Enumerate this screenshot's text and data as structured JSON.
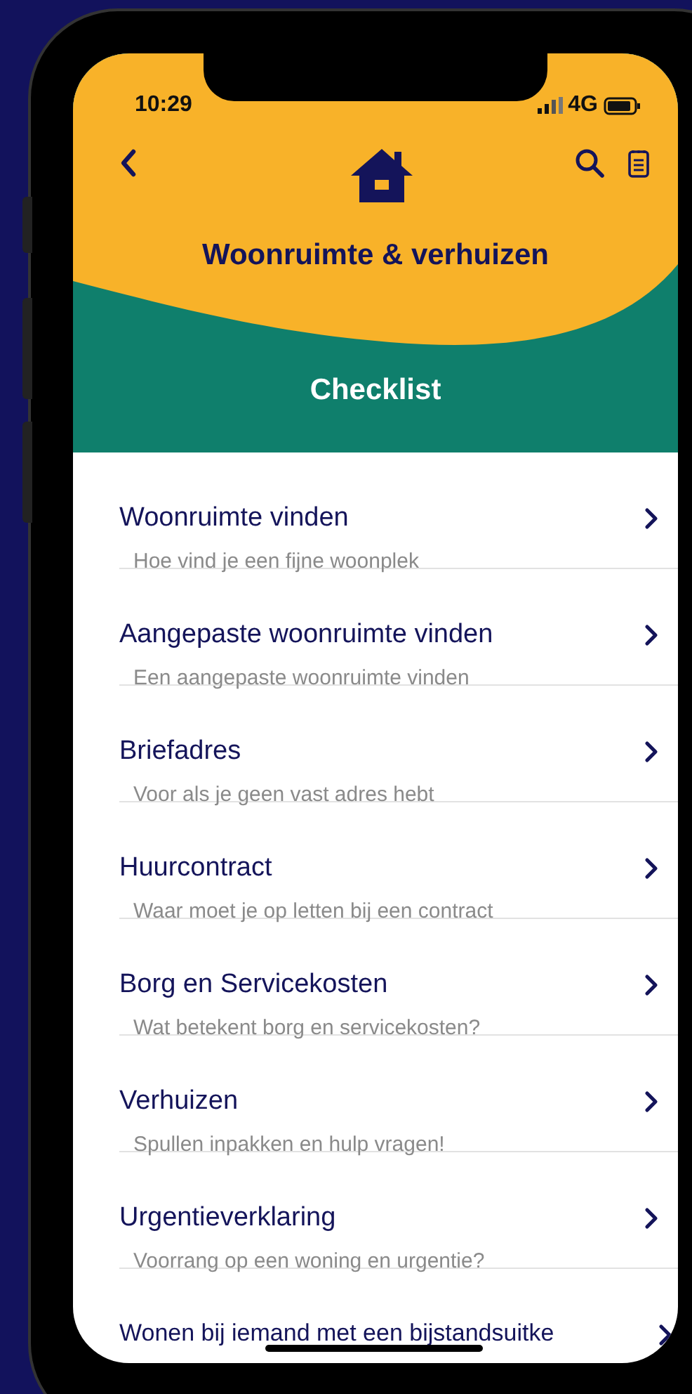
{
  "status_bar": {
    "time": "10:29",
    "network": "4G"
  },
  "header": {
    "title": "Woonruimte & verhuizen",
    "section_title": "Checklist"
  },
  "items": [
    {
      "title": "Woonruimte vinden",
      "subtitle": "Hoe vind je een fijne woonplek"
    },
    {
      "title": "Aangepaste woonruimte vinden",
      "subtitle": "Een aangepaste woonruimte vinden"
    },
    {
      "title": "Briefadres",
      "subtitle": "Voor als je geen vast adres hebt"
    },
    {
      "title": "Huurcontract",
      "subtitle": "Waar moet je op letten bij een contract"
    },
    {
      "title": "Borg en Servicekosten",
      "subtitle": "Wat betekent borg en servicekosten?"
    },
    {
      "title": "Verhuizen",
      "subtitle": "Spullen inpakken en hulp vragen!"
    },
    {
      "title": "Urgentieverklaring",
      "subtitle": "Voorrang op een woning en urgentie?"
    },
    {
      "title": "Wonen bij iemand met een bijstandsuitke"
    }
  ]
}
